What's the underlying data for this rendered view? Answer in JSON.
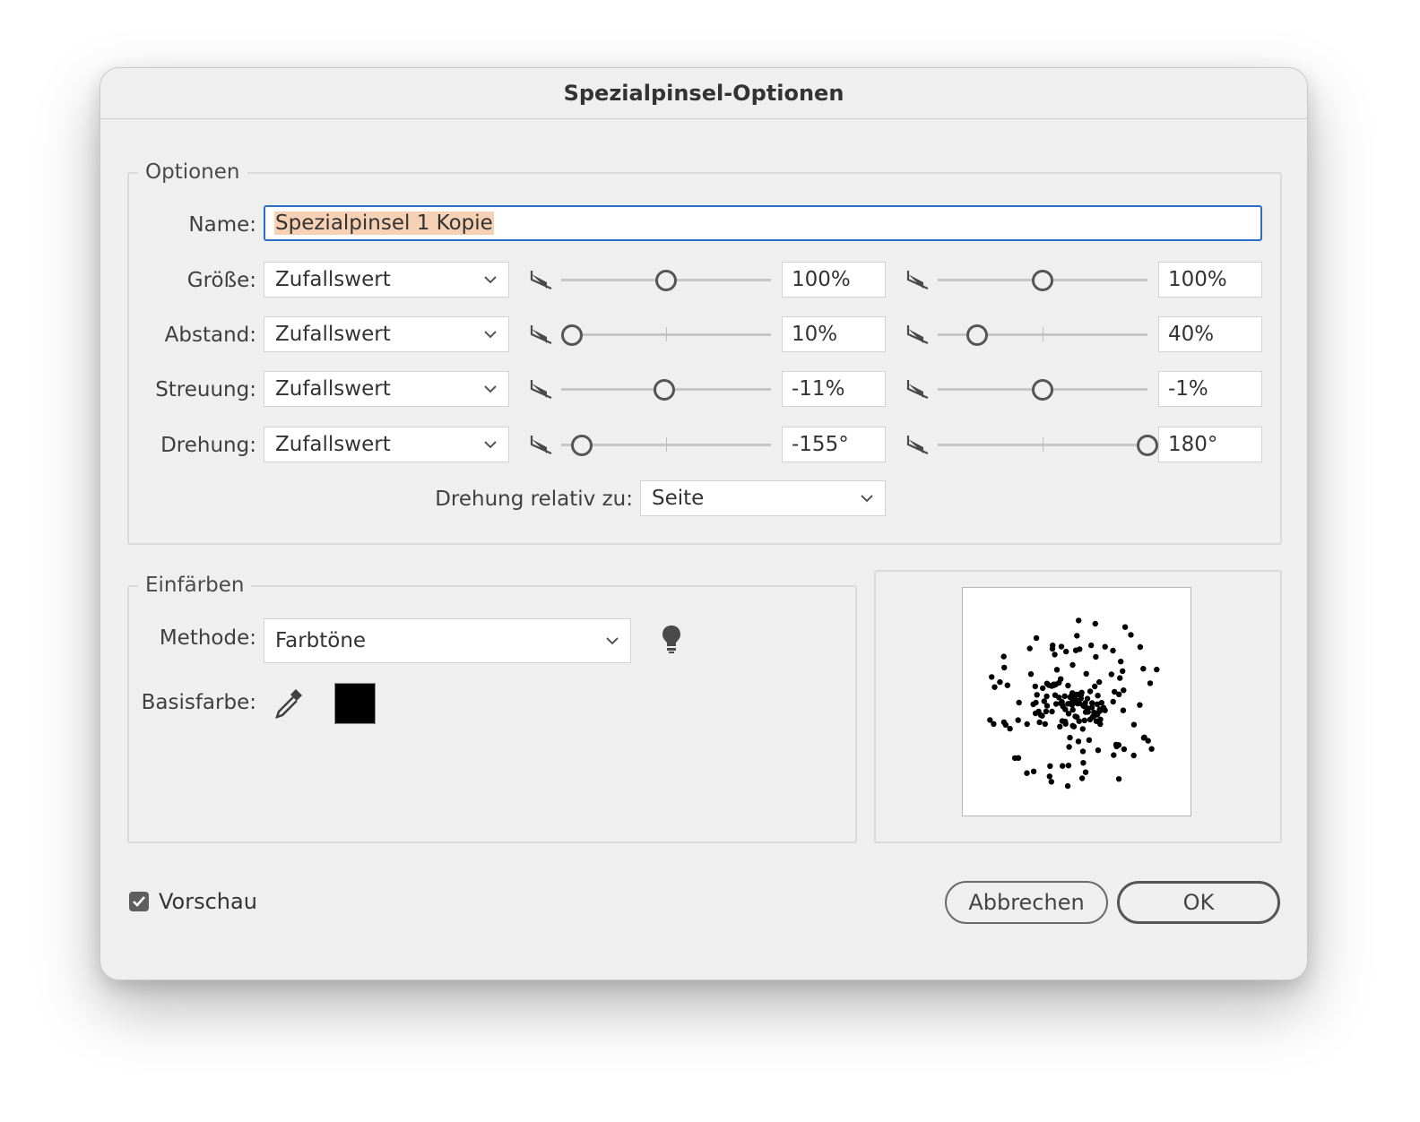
{
  "dialog": {
    "title": "Spezialpinsel-Optionen"
  },
  "options": {
    "legend": "Optionen",
    "name_label": "Name:",
    "name_value": "Spezialpinsel 1 Kopie",
    "rows": [
      {
        "label": "Größe:",
        "mode": "Zufallswert",
        "min_value": "100%",
        "max_value": "100%",
        "min_pos": 0.5,
        "max_pos": 0.5
      },
      {
        "label": "Abstand:",
        "mode": "Zufallswert",
        "min_value": "10%",
        "max_value": "40%",
        "min_pos": 0.05,
        "max_pos": 0.19
      },
      {
        "label": "Streuung:",
        "mode": "Zufallswert",
        "min_value": "-11%",
        "max_value": "-1%",
        "min_pos": 0.49,
        "max_pos": 0.5
      },
      {
        "label": "Drehung:",
        "mode": "Zufallswert",
        "min_value": "-155°",
        "max_value": "180°",
        "min_pos": 0.1,
        "max_pos": 1.0
      }
    ],
    "rotation_relative_label": "Drehung relativ zu:",
    "rotation_relative_value": "Seite"
  },
  "colorize": {
    "legend": "Einfärben",
    "method_label": "Methode:",
    "method_value": "Farbtöne",
    "base_color_label": "Basisfarbe:",
    "base_color": "#000000",
    "tip_icon": "lightbulb-icon",
    "eyedropper_icon": "eyedropper-icon"
  },
  "preview": {
    "checkbox_label": "Vorschau",
    "checked": true
  },
  "buttons": {
    "cancel": "Abbrechen",
    "ok": "OK"
  }
}
